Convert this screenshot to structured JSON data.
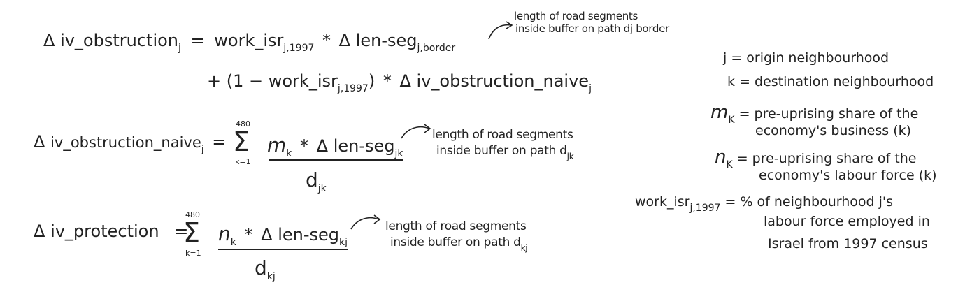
{
  "equations": {
    "eq1": {
      "delta": "Δ",
      "lhs": "iv_obstruction",
      "lhs_sub": "j",
      "eq": "=",
      "t1": "work_isr",
      "t1_sub": "j,1997",
      "times": "*",
      "delta2": "Δ",
      "t2": "len-seg",
      "t2_sub": "j,border",
      "note1": "length of road segments",
      "note2": "inside buffer on path dj border",
      "line2_open": "+ (1 − work_isr",
      "line2_sub": "j,1997",
      "line2_close": ")",
      "line2_times": "*",
      "line2_delta": "Δ",
      "line2_t": "iv_obstruction_naive",
      "line2_t_sub": "j"
    },
    "eq2": {
      "delta": "Δ",
      "lhs": "iv_obstruction_naive",
      "lhs_sub": "j",
      "eq": "=",
      "sum_upper": "480",
      "sum_sym": "Σ",
      "sum_lower": "k=1",
      "num_var": "m",
      "num_var_sub": "k",
      "num_times": "*",
      "num_delta": "Δ",
      "num_t": "len-seg",
      "num_t_sub": "jk",
      "den": "d",
      "den_sub": "jk",
      "note1": "length of road segments",
      "note2": "inside buffer on path d",
      "note2_sub": "jk"
    },
    "eq3": {
      "delta": "Δ",
      "lhs": "iv_protection",
      "eq": "=",
      "sum_upper": "480",
      "sum_sym": "Σ",
      "sum_lower": "k=1",
      "num_var": "n",
      "num_var_sub": "k",
      "num_times": "*",
      "num_delta": "Δ",
      "num_t": "len-seg",
      "num_t_sub": "kj",
      "den": "d",
      "den_sub": "kj",
      "note1": "length of road segments",
      "note2": "inside buffer on path d",
      "note2_sub": "kj"
    }
  },
  "legend": {
    "j_def": "j = origin neighbourhood",
    "k_def": "k = destination neighbourhood",
    "m_sym": "m",
    "m_sub": "K",
    "m_def_1": "= pre-uprising share of the",
    "m_def_2": "economy's business (k)",
    "n_sym": "n",
    "n_sub": "K",
    "n_def_1": "= pre-uprising share of the",
    "n_def_2": "economy's labour force (k)",
    "w_sym": "work_isr",
    "w_sub": "j,1997",
    "w_def_1": "= % of neighbourhood j's",
    "w_def_2": "labour force employed in",
    "w_def_3": "Israel from 1997 census"
  }
}
